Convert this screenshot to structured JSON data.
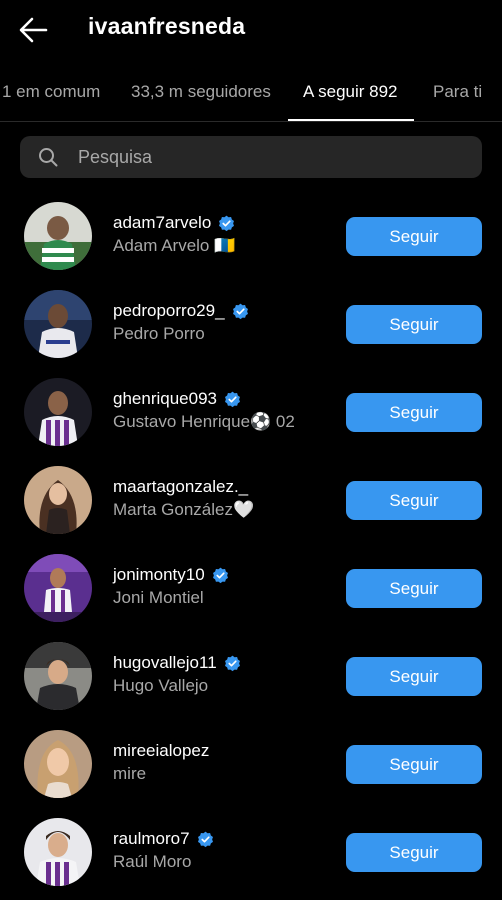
{
  "header": {
    "title": "ivaanfresneda"
  },
  "tabs": [
    {
      "label": "1 em comum"
    },
    {
      "label": "33,3 m seguidores"
    },
    {
      "label": "A seguir 892"
    },
    {
      "label": "Para ti"
    }
  ],
  "search": {
    "placeholder": "Pesquisa"
  },
  "accent_color": "#3897f0",
  "users": [
    {
      "username": "adam7arvelo",
      "verified": true,
      "name": "Adam Arvelo 🇮🇨",
      "button": "Seguir"
    },
    {
      "username": "pedroporro29_",
      "verified": true,
      "name": "Pedro Porro",
      "button": "Seguir"
    },
    {
      "username": "ghenrique093",
      "verified": true,
      "name": "Gustavo Henrique⚽ 02",
      "button": "Seguir"
    },
    {
      "username": "maartagonzalez._",
      "verified": false,
      "name": "Marta González🤍",
      "button": "Seguir"
    },
    {
      "username": "jonimonty10",
      "verified": true,
      "name": "Joni Montiel",
      "button": "Seguir"
    },
    {
      "username": "hugovallejo11",
      "verified": true,
      "name": "Hugo Vallejo",
      "button": "Seguir"
    },
    {
      "username": "mireeialopez",
      "verified": false,
      "name": "mire",
      "button": "Seguir"
    },
    {
      "username": "raulmoro7",
      "verified": true,
      "name": "Raúl Moro",
      "button": "Seguir"
    }
  ]
}
